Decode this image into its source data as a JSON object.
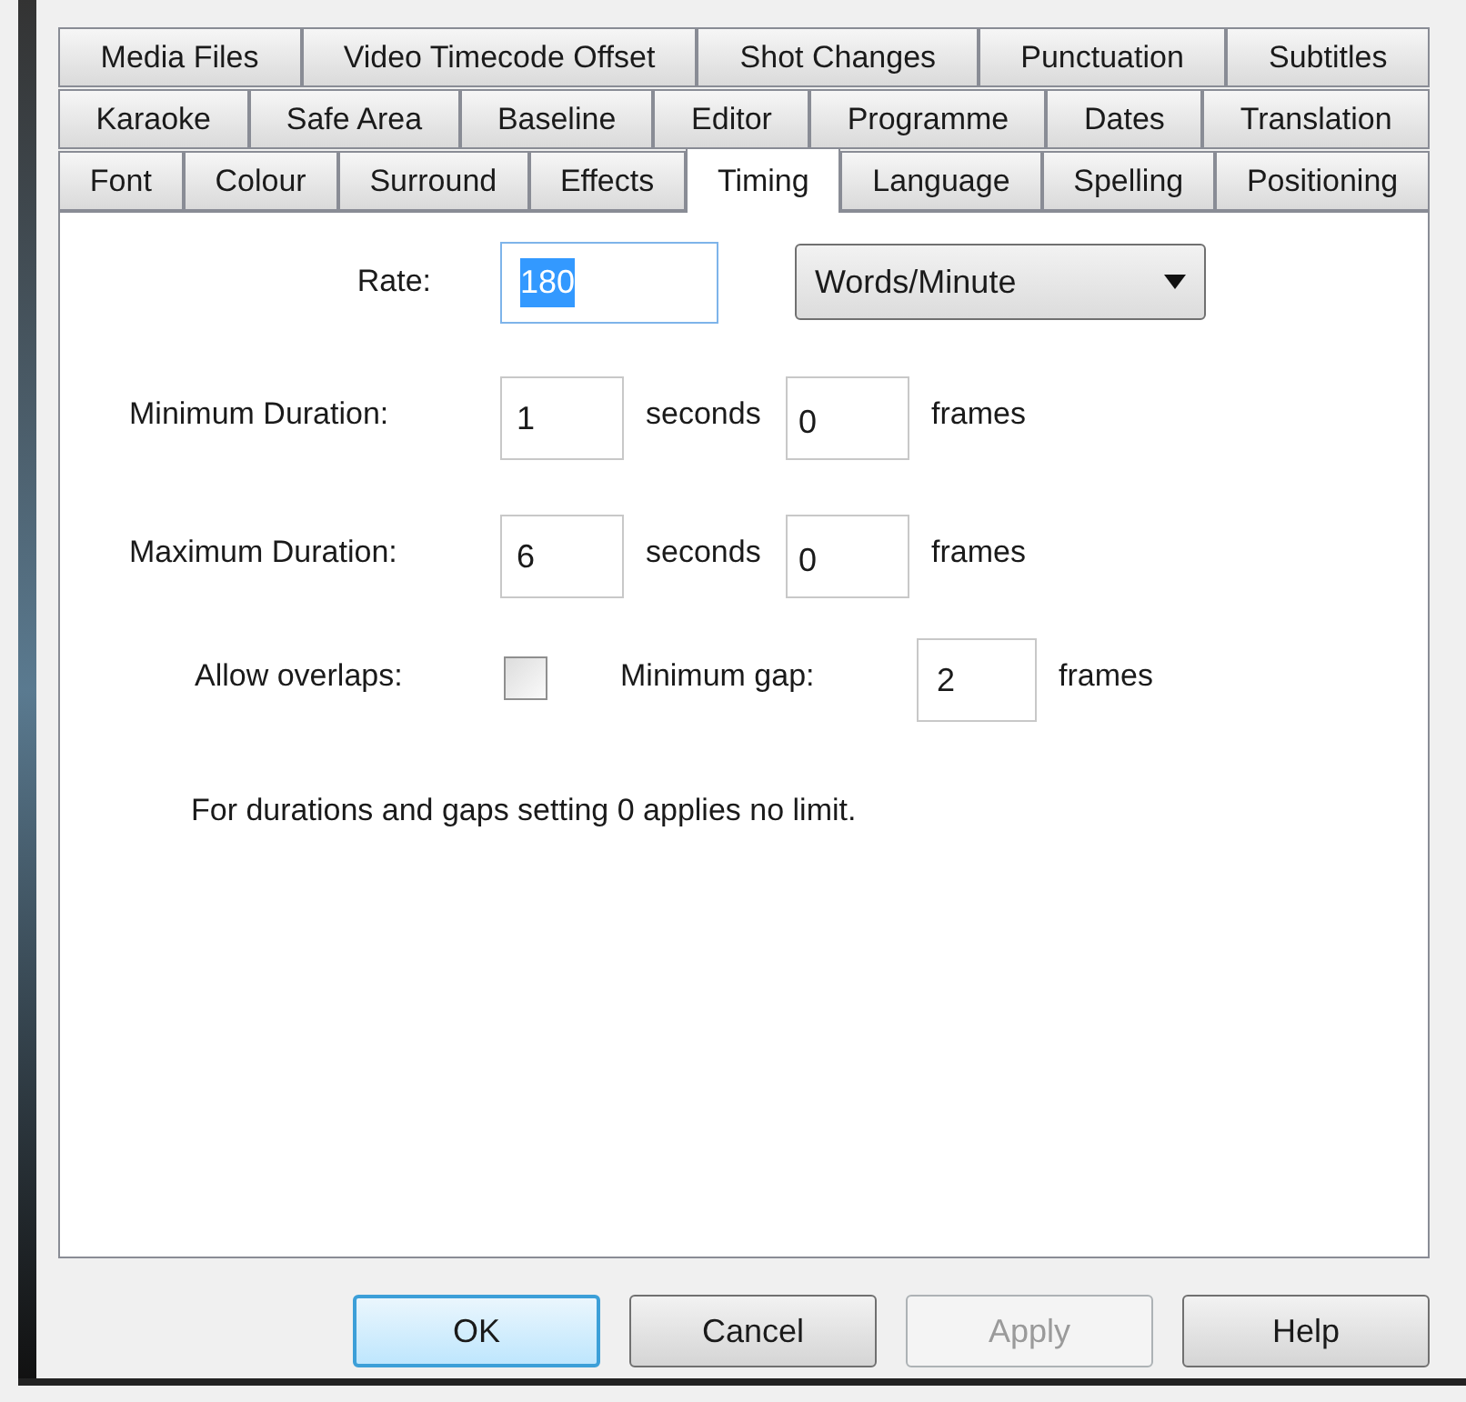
{
  "tab_rows": [
    [
      {
        "label": "Media Files",
        "selected": false
      },
      {
        "label": "Video Timecode Offset",
        "selected": false
      },
      {
        "label": "Shot Changes",
        "selected": false
      },
      {
        "label": "Punctuation",
        "selected": false
      },
      {
        "label": "Subtitles",
        "selected": false
      }
    ],
    [
      {
        "label": "Karaoke",
        "selected": false
      },
      {
        "label": "Safe Area",
        "selected": false
      },
      {
        "label": "Baseline",
        "selected": false
      },
      {
        "label": "Editor",
        "selected": false
      },
      {
        "label": "Programme",
        "selected": false
      },
      {
        "label": "Dates",
        "selected": false
      },
      {
        "label": "Translation",
        "selected": false
      }
    ],
    [
      {
        "label": "Font",
        "selected": false
      },
      {
        "label": "Colour",
        "selected": false
      },
      {
        "label": "Surround",
        "selected": false
      },
      {
        "label": "Effects",
        "selected": false
      },
      {
        "label": "Timing",
        "selected": true
      },
      {
        "label": "Language",
        "selected": false
      },
      {
        "label": "Spelling",
        "selected": false
      },
      {
        "label": "Positioning",
        "selected": false
      }
    ]
  ],
  "rate": {
    "label": "Rate:",
    "value": "180",
    "value_selected": true,
    "unit": "Words/Minute"
  },
  "durations": [
    {
      "label": "Minimum Duration:",
      "seconds": "1",
      "seconds_unit": "seconds",
      "frames": "0",
      "frames_unit": "frames"
    },
    {
      "label": "Maximum Duration:",
      "seconds": "6",
      "seconds_unit": "seconds",
      "frames": "0",
      "frames_unit": "frames"
    }
  ],
  "overlaps": {
    "label": "Allow overlaps:",
    "checked": false
  },
  "min_gap": {
    "label": "Minimum gap:",
    "value": "2",
    "unit": "frames"
  },
  "note": "For durations and gaps setting 0 applies no limit.",
  "buttons": [
    {
      "label": "OK",
      "kind": "default",
      "disabled": false
    },
    {
      "label": "Cancel",
      "kind": "normal",
      "disabled": false
    },
    {
      "label": "Apply",
      "kind": "normal",
      "disabled": true
    },
    {
      "label": "Help",
      "kind": "normal",
      "disabled": false
    }
  ]
}
